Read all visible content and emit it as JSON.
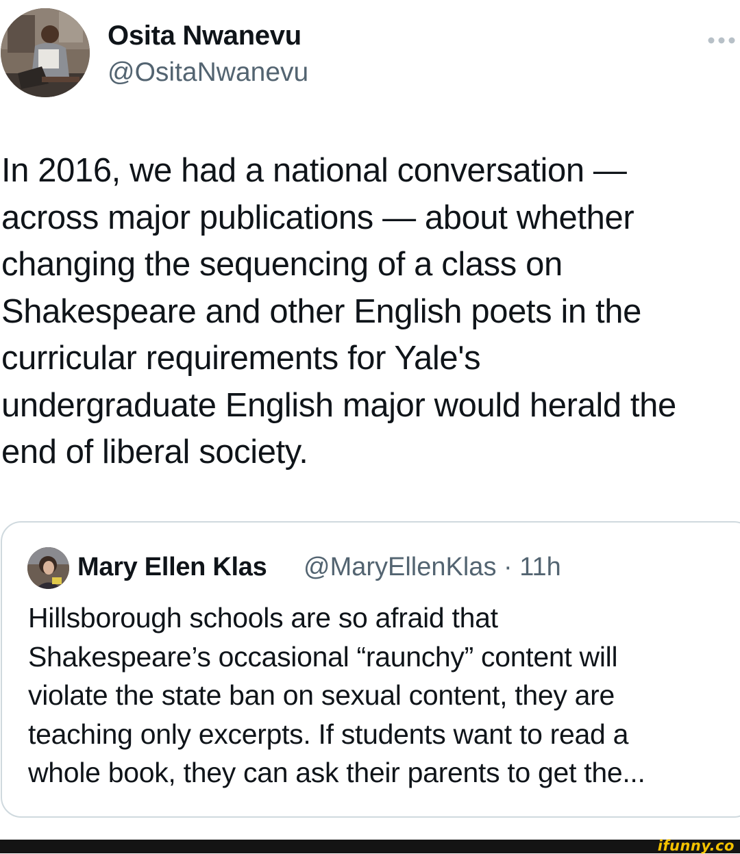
{
  "tweet": {
    "author": {
      "name": "Osita Nwanevu",
      "handle": "@OsitaNwanevu",
      "avatar_icon": "author-avatar-photo"
    },
    "more_icon": "ellipsis-icon",
    "text_lines": [
      "In 2016, we had a national conversation —",
      "across major publications — about whether",
      "changing the sequencing of a class on",
      "Shakespeare and other English poets in the",
      "curricular requirements for Yale's",
      "undergraduate English major would herald the",
      "end of liberal society."
    ]
  },
  "quote": {
    "author": {
      "name": "Mary Ellen Klas",
      "handle_and_time": "@MaryEllenKlas · 11h",
      "avatar_icon": "quoted-author-avatar-photo"
    },
    "text_lines": [
      "Hillsborough schools are so afraid that",
      "Shakespeare’s occasional “raunchy”  content will",
      "violate the state ban on sexual content, they are",
      "teaching only excerpts. If students want to read a",
      "whole book, they can ask their parents to get the..."
    ]
  },
  "footer": {
    "watermark": "ifunny.co"
  },
  "colors": {
    "text_primary": "#0f1419",
    "text_secondary": "#536471",
    "border": "#cfd9de",
    "footer_bg": "#141414",
    "watermark": "#f4c200"
  }
}
